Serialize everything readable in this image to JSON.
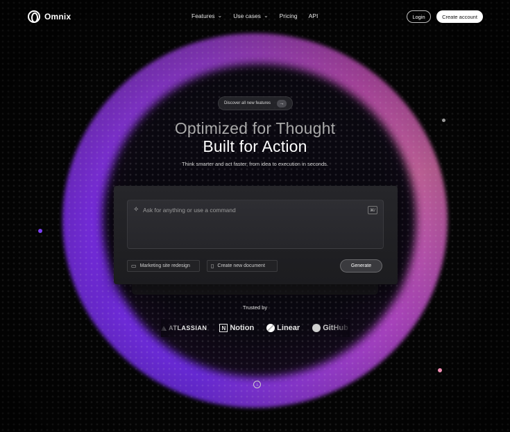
{
  "brand": {
    "name": "Omnix"
  },
  "nav": {
    "items": [
      {
        "label": "Features",
        "has_dropdown": true
      },
      {
        "label": "Use cases",
        "has_dropdown": true
      },
      {
        "label": "Pricing",
        "has_dropdown": false
      },
      {
        "label": "API",
        "has_dropdown": false
      }
    ],
    "login": "Login",
    "create_account": "Create account"
  },
  "hero": {
    "pill_label": "Discover all new features",
    "pill_arrow": "→",
    "headline_line1": "Optimized for Thought",
    "headline_line2": "Built for Action",
    "subtitle": "Think smarter and act faster, from idea to execution in seconds."
  },
  "prompt": {
    "placeholder": "Ask for anything or use a command",
    "shortcut": "⌘/",
    "chips": [
      {
        "label": "Marketing site redesign",
        "icon": "folder-icon"
      },
      {
        "label": "Create new document",
        "icon": "document-icon"
      }
    ],
    "generate_label": "Generate"
  },
  "trusted": {
    "label": "Trusted by",
    "logos": [
      "ATLASSIAN",
      "Notion",
      "Linear",
      "GitHub"
    ]
  },
  "colors": {
    "accent_purple": "#7b2ee6",
    "accent_pink": "#d26aa6",
    "background": "#050505"
  }
}
